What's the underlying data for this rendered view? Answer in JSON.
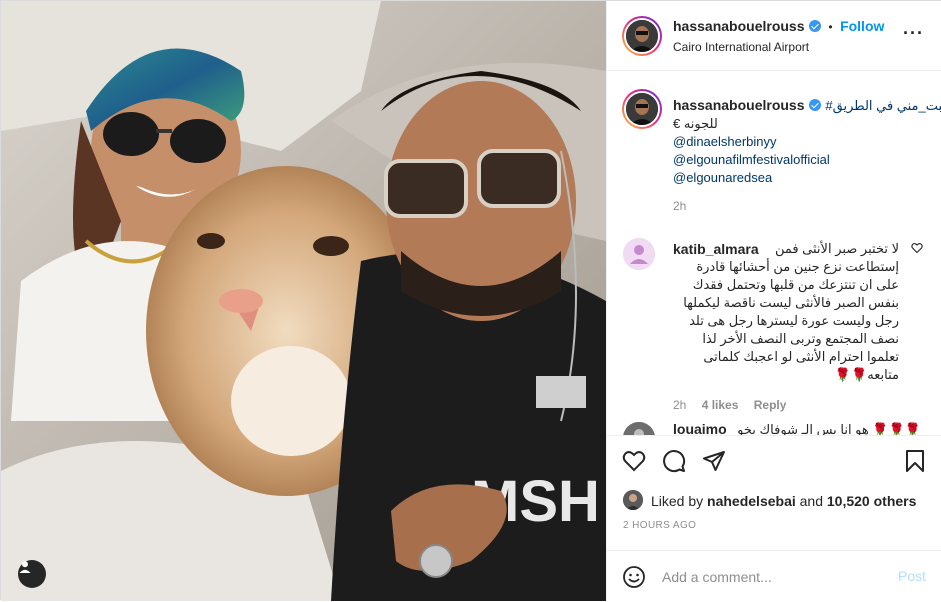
{
  "post": {
    "username": "hassanabouelrouss",
    "follow_label": "Follow",
    "follow_separator": "•",
    "location": "Cairo International Airport",
    "more_label": "···"
  },
  "caption": {
    "username": "hassanabouelrouss",
    "text_line1": "#قلبت_مني في الطريق",
    "text_line2": "للجونه €",
    "mentions": [
      "@dinaelsherbinyy",
      "@elgounafilmfestivalofficial",
      "@elgounaredsea"
    ],
    "time": "2h"
  },
  "comments": [
    {
      "username": "katib_almara",
      "text": "لا تختبر صبر الأنثى فمن إستطاعت نزع جنين من أحشائها قادرة على ان تنتزعك من قلبها وتحتمل فقدك بنفس الصبر فالأنثى ليست ناقصة ليكملها رجل وليست عورة ليسترها رجل هى تلد نصف المجتمع وتربى النصف الأخر لذا تعلموا احترام الأنثى لو اعجبك كلماتى متابعه🌹🌹",
      "time": "2h",
      "likes": "4 likes",
      "reply_label": "Reply"
    },
    {
      "username": "louaimo",
      "text": "هو انا بس الـ شوفاك يخو 🌹🌹🌹"
    }
  ],
  "actions": {
    "liked_by_prefix": "Liked by",
    "liked_by_user": "nahedelsebai",
    "liked_by_and": "and",
    "liked_by_others": "10,520 others",
    "timestamp": "2 HOURS AGO"
  },
  "add_comment": {
    "placeholder": "Add a comment...",
    "post_label": "Post"
  },
  "colors": {
    "accent": "#0095f6",
    "post_disabled": "#b2dffc",
    "text_secondary": "#8e8e8e"
  }
}
